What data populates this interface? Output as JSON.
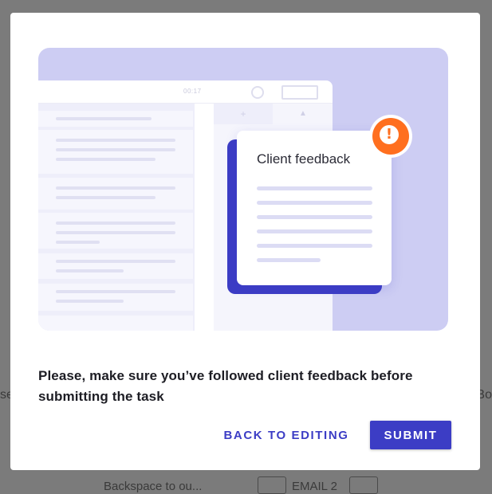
{
  "background": {
    "left_fragment": "se",
    "right_fragment": "Bo",
    "bottom_text": "Backspace to ou...",
    "bottom_text2": "EMAIL 2"
  },
  "modal": {
    "illustration": {
      "app_timer": "00:17",
      "card_title": "Client feedback",
      "alert_icon": "exclamation-icon",
      "tab_icon_a": "+",
      "tab_icon_b": "▲"
    },
    "message": "Please, make sure you’ve followed client feedback before submitting the task",
    "back_button": "BACK TO EDITING",
    "submit_button": "SUBMIT"
  },
  "colors": {
    "accent": "#3c3dc5",
    "alert": "#ff6f1f",
    "illustration_bg": "#cdcdf3"
  }
}
